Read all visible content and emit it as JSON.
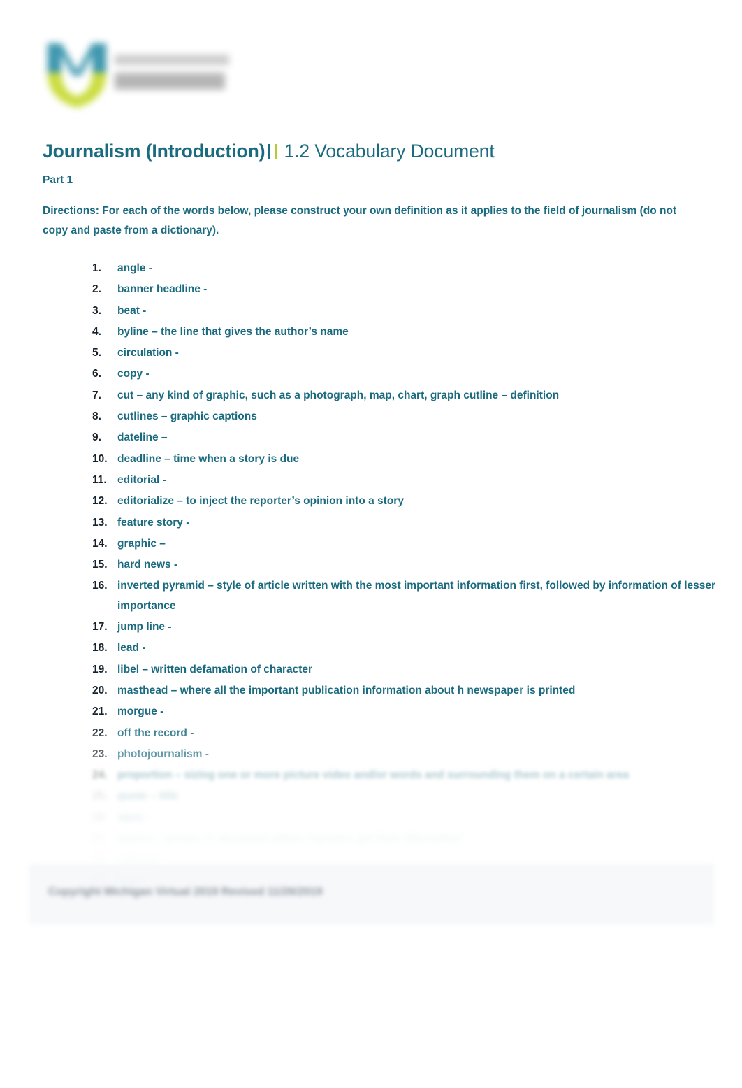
{
  "document": {
    "logo": {
      "mark_name": "michigan-virtual-m-logo",
      "mark_color_top": "#2f8fa8",
      "mark_color_bottom": "#c6d92e",
      "wordmark_blurred": true
    },
    "title": {
      "bold_part": "Journalism (Introduction)",
      "separator_teal": "|",
      "separator_lime": "|",
      "regular_part": "1.2 Vocabulary Document"
    },
    "part_heading": "Part 1",
    "directions": "Directions:  For each of the words below, please construct your own definition as it applies to the field of journalism (do not copy and paste from a dictionary).",
    "colors": {
      "teal": "#1b6b80",
      "lime": "#b5cc2e",
      "number_dark": "#15212b",
      "panel_bg": "#f5f7fa"
    },
    "vocab_items": [
      {
        "number": "1.",
        "text": "angle -",
        "blurred": false
      },
      {
        "number": "2.",
        "text": "banner headline -",
        "blurred": false
      },
      {
        "number": "3.",
        "text": "beat -",
        "blurred": false
      },
      {
        "number": "4.",
        "text": "byline – the line that gives the author’s name",
        "blurred": false
      },
      {
        "number": "5.",
        "text": "circulation -",
        "blurred": false
      },
      {
        "number": "6.",
        "text": "copy -",
        "blurred": false
      },
      {
        "number": "7.",
        "text": "cut  – any kind of graphic, such as a photograph, map, chart, graph cutline – definition",
        "blurred": false
      },
      {
        "number": "8.",
        "text": "cutlines – graphic captions",
        "blurred": false
      },
      {
        "number": "9.",
        "text": "dateline –",
        "blurred": false
      },
      {
        "number": "10.",
        "text": "deadline – time when a story is due",
        "blurred": false
      },
      {
        "number": "11.",
        "text": "editorial -",
        "blurred": false
      },
      {
        "number": "12.",
        "text": "editorialize – to inject the reporter’s opinion into a story",
        "blurred": false
      },
      {
        "number": "13.",
        "text": "feature story -",
        "blurred": false
      },
      {
        "number": "14.",
        "text": "graphic –",
        "blurred": false
      },
      {
        "number": "15.",
        "text": "hard news -",
        "blurred": false
      },
      {
        "number": "16.",
        "text": "inverted pyramid – style of article written with the most important information first, followed by information of lesser importance",
        "blurred": false
      },
      {
        "number": "17.",
        "text": "jump line -",
        "blurred": false
      },
      {
        "number": "18.",
        "text": "lead -",
        "blurred": false
      },
      {
        "number": "19.",
        "text": "libel – written defamation of character",
        "blurred": false
      },
      {
        "number": "20.",
        "text": "masthead – where all the important publication information about h newspaper is printed",
        "blurred": false
      },
      {
        "number": "21.",
        "text": "morgue -",
        "blurred": false
      },
      {
        "number": "22.",
        "text": "off the record -",
        "blurred": false
      },
      {
        "number": "23.",
        "text": "photojournalism -",
        "blurred": false
      },
      {
        "number": "24.",
        "text": "proportion – sizing one or more picture video and/or words and surrounding them on a certain area",
        "blurred": true
      },
      {
        "number": "25.",
        "text": "quote – title",
        "blurred": true
      },
      {
        "number": "26.",
        "text": "slant -",
        "blurred": true
      },
      {
        "number": "27.",
        "text": "source – person or document where reporters get their information",
        "blurred": true
      },
      {
        "number": "28.",
        "text": "editorial",
        "blurred": true
      },
      {
        "number": "29.",
        "text": "story",
        "blurred": true
      }
    ],
    "bottom_panel": {
      "text": "Copyright Michigan Virtual 2019 Revised 11/26/2019",
      "blurred": true
    }
  }
}
